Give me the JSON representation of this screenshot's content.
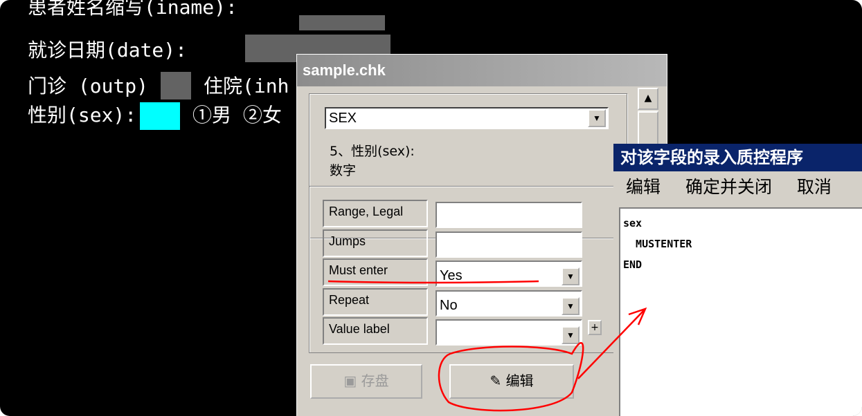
{
  "console": {
    "line1": "患者姓名缩写(iname):",
    "line2": "就诊日期(date):",
    "line3a": "门诊 (outp)",
    "line3b": "住院(inh",
    "line4a": "性别(sex):",
    "line4b": "①男 ②女"
  },
  "chk_window": {
    "title": "sample.chk",
    "field_select": "SEX",
    "field_info_line1": "5、性别(sex):",
    "field_info_line2": "数字",
    "properties": [
      {
        "label": "Range, Legal",
        "value": ""
      },
      {
        "label": "Jumps",
        "value": ""
      },
      {
        "label": "Must enter",
        "value": "Yes"
      },
      {
        "label": "Repeat",
        "value": "No"
      },
      {
        "label": "Value label",
        "value": ""
      }
    ],
    "plus_label": "+",
    "save_button": "存盘",
    "edit_button": "编辑"
  },
  "editor": {
    "title": "对该字段的录入质控程序",
    "menu": [
      "编辑",
      "确定并关闭",
      "取消"
    ],
    "code_lines": [
      "sex",
      "  MUSTENTER",
      "END"
    ]
  },
  "colors": {
    "annotation": "#ff0000",
    "cyan_field": "#00ffff",
    "editor_title_bg": "#0a246a"
  }
}
